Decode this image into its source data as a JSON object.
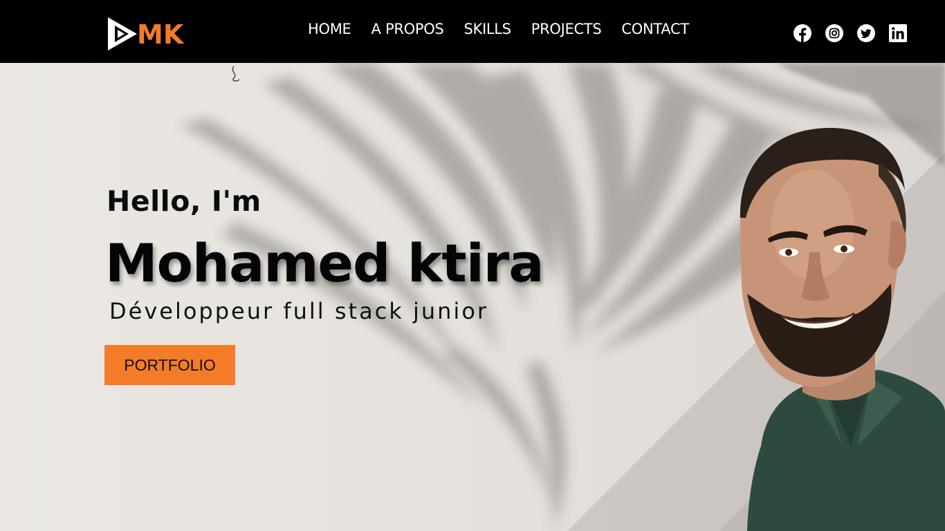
{
  "header": {
    "logo_text": "MK",
    "nav": [
      {
        "label": "HOME"
      },
      {
        "label": "A PROPOS"
      },
      {
        "label": "SKILLS"
      },
      {
        "label": "PROJECTS"
      },
      {
        "label": "CONTACT"
      }
    ],
    "socials": [
      {
        "icon": "facebook-icon"
      },
      {
        "icon": "instagram-icon"
      },
      {
        "icon": "twitter-icon"
      },
      {
        "icon": "linkedin-icon"
      }
    ]
  },
  "hero": {
    "greeting": "Hello, I'm",
    "name": "Mohamed ktira",
    "role": "Développeur full stack junior",
    "cta_label": "PORTFOLIO"
  },
  "colors": {
    "accent": "#f47b28",
    "header_bg": "#000000",
    "hero_bg": "#e9e6e1"
  }
}
